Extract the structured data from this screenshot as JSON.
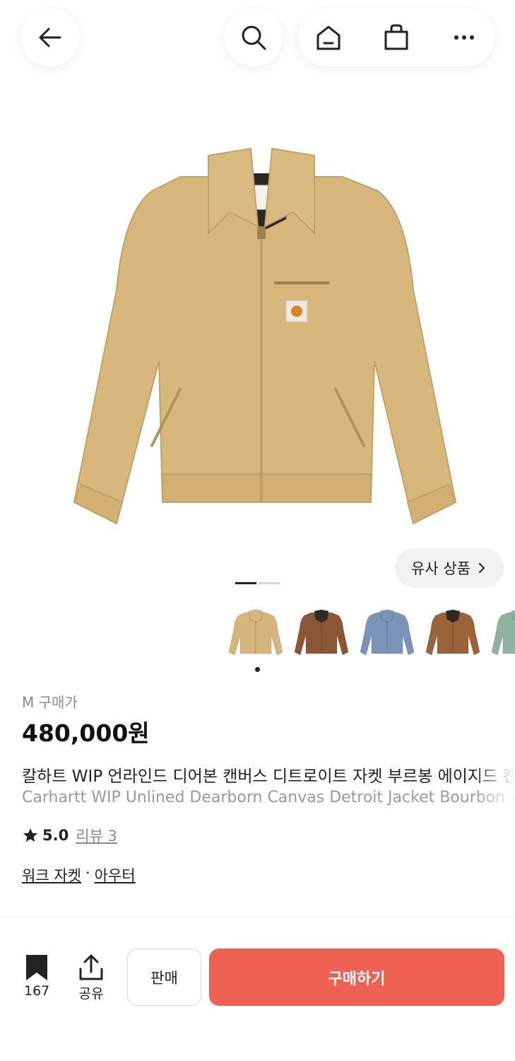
{
  "header": {
    "icons": [
      "arrow-left-icon",
      "search-icon",
      "home-icon",
      "shopping-bag-icon",
      "more-icon"
    ]
  },
  "gallery": {
    "similar_label": "유사 상품",
    "page_count": 2,
    "active_page": 1,
    "thumbnails": [
      {
        "color": "#d6b67c",
        "collar": "#d6b67c"
      },
      {
        "color": "#8a5634",
        "collar": "#2e2a26"
      },
      {
        "color": "#7a94b8",
        "collar": "#7a94b8"
      },
      {
        "color": "#9a6438",
        "collar": "#2e2a26"
      },
      {
        "color": "#8fb3a0",
        "collar": "#8fb3a0"
      }
    ],
    "selected_thumbnail": 0,
    "jacket_color": "#d7b77c"
  },
  "product": {
    "size_label": "M 구매가",
    "price": "480,000원",
    "name_ko": "칼하트 WIP 언라인드 디어본 캔버스 디트로이트 자켓 부르봉 에이지드 캔버스",
    "name_en": "Carhartt WIP Unlined Dearborn Canvas Detroit Jacket Bourbon Aged Canvas",
    "rating": "5.0",
    "review_label": "리뷰 3",
    "category_1": "워크 자켓",
    "category_sep": "·",
    "category_2": "아우터"
  },
  "bottom": {
    "bookmark_count": "167",
    "share_label": "공유",
    "sell_label": "판매",
    "buy_label": "구매하기",
    "buy_color": "#ef6253"
  }
}
